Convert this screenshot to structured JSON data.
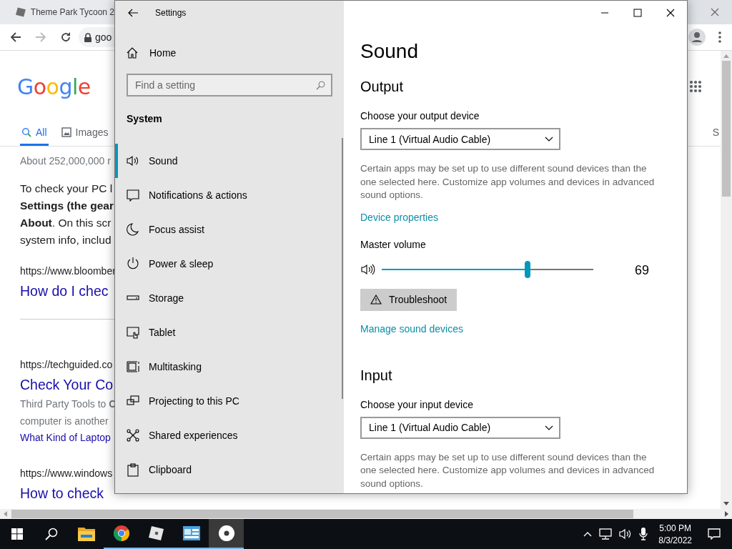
{
  "browser": {
    "tabs": [
      {
        "title": "Theme Park Tycoon 2",
        "selected": true
      }
    ],
    "forward_disabled": true,
    "address": "goo",
    "page": {
      "logo": "Google",
      "search_tabs": [
        {
          "label": "All",
          "selected": true
        },
        {
          "label": "Images",
          "selected": false
        },
        {
          "label": "S",
          "selected": false
        }
      ],
      "lines": [
        {
          "kind": "count",
          "text": "About 252,000,000 r"
        },
        {
          "kind": "para",
          "text": "To check your PC l"
        },
        {
          "kind": "para",
          "text": "**Settings (the gear**"
        },
        {
          "kind": "para",
          "text": "**About**. On this scr"
        },
        {
          "kind": "para",
          "text": "system info, includ"
        },
        {
          "kind": "url",
          "text": "https://www.bloomber"
        },
        {
          "kind": "title",
          "text": "How do I chec"
        },
        {
          "kind": "divider"
        },
        {
          "kind": "url",
          "text": "https://techguided.co"
        },
        {
          "kind": "title",
          "text": "Check Your Co"
        },
        {
          "kind": "snippet",
          "text": "Third Party Tools to **C**"
        },
        {
          "kind": "snippet",
          "text": "computer is another"
        },
        {
          "kind": "sublink",
          "text": "What Kind of Laptop"
        },
        {
          "kind": "url",
          "text": "https://www.windows"
        },
        {
          "kind": "title",
          "text": "How to check"
        }
      ]
    }
  },
  "settings": {
    "title": "Settings",
    "home": "Home",
    "search_placeholder": "Find a setting",
    "section": "System",
    "nav": [
      {
        "label": "Sound",
        "selected": true
      },
      {
        "label": "Notifications & actions",
        "selected": false
      },
      {
        "label": "Focus assist",
        "selected": false
      },
      {
        "label": "Power & sleep",
        "selected": false
      },
      {
        "label": "Storage",
        "selected": false
      },
      {
        "label": "Tablet",
        "selected": false
      },
      {
        "label": "Multitasking",
        "selected": false
      },
      {
        "label": "Projecting to this PC",
        "selected": false
      },
      {
        "label": "Shared experiences",
        "selected": false
      },
      {
        "label": "Clipboard",
        "selected": false
      }
    ],
    "content": [
      {
        "kind": "title",
        "text": "Sound"
      },
      {
        "kind": "heading",
        "text": "Output"
      },
      {
        "kind": "label",
        "text": "Choose your output device"
      },
      {
        "kind": "dropdown",
        "text": "Line 1 (Virtual Audio Cable)"
      },
      {
        "kind": "note",
        "text": "Certain apps may be set up to use different sound devices than the one selected here. Customize app volumes and devices in advanced sound options."
      },
      {
        "kind": "link",
        "text": "Device properties"
      },
      {
        "kind": "label",
        "text": "Master volume"
      },
      {
        "kind": "slider",
        "level": 0.69,
        "reading": "69"
      },
      {
        "kind": "button",
        "text": "Troubleshoot"
      },
      {
        "kind": "link",
        "text": "Manage sound devices"
      },
      {
        "kind": "heading",
        "text": "Input"
      },
      {
        "kind": "label",
        "text": "Choose your input device"
      },
      {
        "kind": "dropdown",
        "text": "Line 1 (Virtual Audio Cable)"
      },
      {
        "kind": "note",
        "text": "Certain apps may be set up to use different sound devices than the one selected here. Customize app volumes and devices in advanced sound options."
      }
    ]
  },
  "taskbar": {
    "apps": [
      {
        "running": false,
        "selected": false
      },
      {
        "running": true,
        "selected": false
      },
      {
        "running": true,
        "selected": false
      },
      {
        "running": true,
        "selected": false
      },
      {
        "running": true,
        "selected": true
      }
    ],
    "time": "5:00 PM",
    "date": "8/3/2022"
  }
}
